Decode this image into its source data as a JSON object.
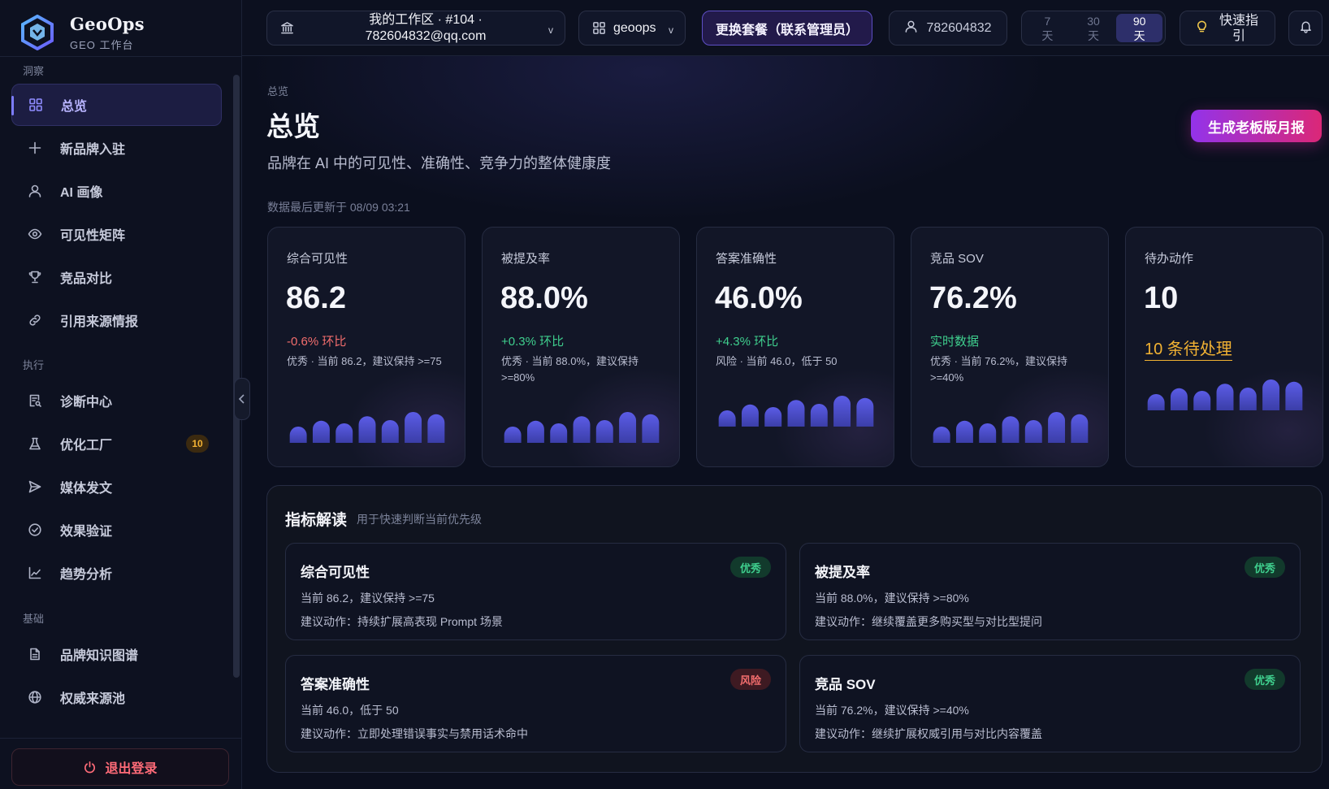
{
  "brand": {
    "name": "GeoOps",
    "subtitle": "GEO 工作台"
  },
  "sidebar": {
    "sections": {
      "insight": "洞察",
      "execute": "执行",
      "base": "基础"
    },
    "items": [
      {
        "label": "总览",
        "icon": "grid-icon",
        "active": true
      },
      {
        "label": "新品牌入驻",
        "icon": "plus-icon"
      },
      {
        "label": "AI 画像",
        "icon": "user-icon"
      },
      {
        "label": "可见性矩阵",
        "icon": "eye-icon"
      },
      {
        "label": "竞品对比",
        "icon": "trophy-icon"
      },
      {
        "label": "引用来源情报",
        "icon": "link-icon"
      },
      {
        "label": "诊断中心",
        "icon": "diagnosis-icon"
      },
      {
        "label": "优化工厂",
        "icon": "flask-icon",
        "badge": "10"
      },
      {
        "label": "媒体发文",
        "icon": "send-icon"
      },
      {
        "label": "效果验证",
        "icon": "check-circle-icon"
      },
      {
        "label": "趋势分析",
        "icon": "chart-line-icon"
      },
      {
        "label": "品牌知识图谱",
        "icon": "document-icon"
      },
      {
        "label": "权威来源池",
        "icon": "globe-icon"
      }
    ],
    "logout": "退出登录"
  },
  "topbar": {
    "workspace_line1": "我的工作区 · #104 ·",
    "workspace_line2": "782604832@qq.com",
    "project": "geoops",
    "upgrade": "更换套餐（联系管理员）",
    "user": "782604832",
    "ranges": [
      {
        "num": "7",
        "unit": "天",
        "active": false
      },
      {
        "num": "30",
        "unit": "天",
        "active": false
      },
      {
        "num": "90",
        "unit": "天",
        "active": true
      }
    ],
    "guide_line1": "快速指",
    "guide_line2": "引"
  },
  "main": {
    "breadcrumb": "总览",
    "title": "总览",
    "subtitle": "品牌在 AI 中的可见性、准确性、竞争力的整体健康度",
    "report_button": "生成老板版月报",
    "updated": "数据最后更新于 08/09 03:21"
  },
  "kpis": [
    {
      "label": "综合可见性",
      "value": "86.2",
      "delta": "-0.6% 环比",
      "tone": "red",
      "note": "优秀 · 当前 86.2，建议保持 >=75",
      "spark": [
        0.5,
        0.68,
        0.6,
        0.82,
        0.7,
        0.95,
        0.88
      ]
    },
    {
      "label": "被提及率",
      "value": "88.0%",
      "delta": "+0.3% 环比",
      "tone": "green",
      "note": "优秀 · 当前 88.0%，建议保持 >=80%",
      "spark": [
        0.5,
        0.68,
        0.6,
        0.82,
        0.7,
        0.95,
        0.88
      ]
    },
    {
      "label": "答案准确性",
      "value": "46.0%",
      "delta": "+4.3% 环比",
      "tone": "green",
      "note": "风险 · 当前 46.0，低于 50",
      "spark": [
        0.5,
        0.68,
        0.6,
        0.82,
        0.7,
        0.95,
        0.88
      ]
    },
    {
      "label": "竞品 SOV",
      "value": "76.2%",
      "delta": "实时数据",
      "tone": "green",
      "note": "优秀 · 当前 76.2%，建议保持 >=40%",
      "spark": [
        0.5,
        0.68,
        0.6,
        0.82,
        0.7,
        0.95,
        0.88
      ]
    },
    {
      "label": "待办动作",
      "value": "10",
      "link": "10 条待处理",
      "spark": [
        0.5,
        0.68,
        0.6,
        0.82,
        0.7,
        0.95,
        0.88
      ]
    }
  ],
  "panel": {
    "title": "指标解读",
    "subtitle": "用于快速判断当前优先级",
    "cards": [
      {
        "title": "综合可见性",
        "status": "优秀",
        "tone": "good",
        "line1": "当前 86.2，建议保持 >=75",
        "line2": "建议动作：持续扩展高表现 Prompt 场景"
      },
      {
        "title": "被提及率",
        "status": "优秀",
        "tone": "good",
        "line1": "当前 88.0%，建议保持 >=80%",
        "line2": "建议动作：继续覆盖更多购买型与对比型提问"
      },
      {
        "title": "答案准确性",
        "status": "风险",
        "tone": "risk",
        "line1": "当前 46.0，低于 50",
        "line2": "建议动作：立即处理错误事实与禁用话术命中"
      },
      {
        "title": "竞品 SOV",
        "status": "优秀",
        "tone": "good",
        "line1": "当前 76.2%，建议保持 >=40%",
        "line2": "建议动作：继续扩展权威引用与对比内容覆盖"
      }
    ]
  },
  "colors": {
    "accent": "#7c7cff",
    "bar_top": "#5b5ce6",
    "bar_bottom": "#3b3ea8",
    "danger": "#f26d6d",
    "success": "#3fcf8e",
    "warning": "#f2b233"
  }
}
